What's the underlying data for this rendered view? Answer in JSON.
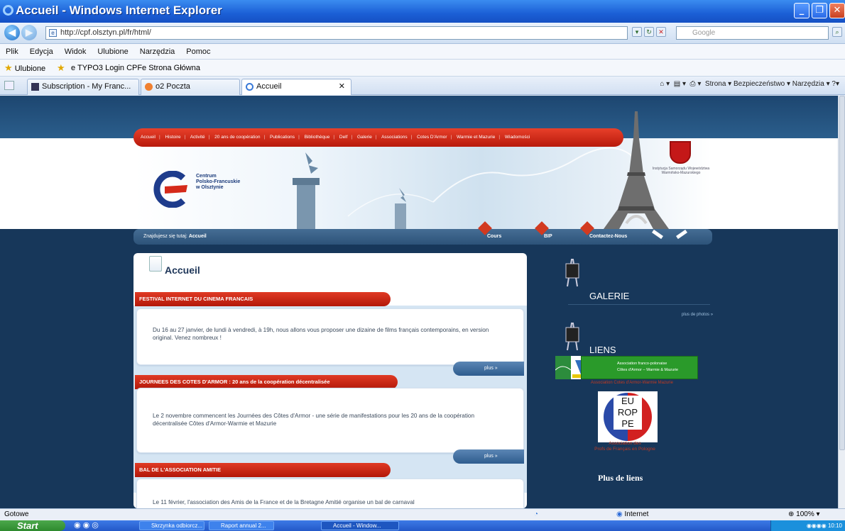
{
  "window": {
    "title": "Accueil - Windows Internet Explorer"
  },
  "address": {
    "url": "http://cpf.olsztyn.pl/fr/html/",
    "search_placeholder": "Google"
  },
  "menu": [
    "Plik",
    "Edycja",
    "Widok",
    "Ulubione",
    "Narzędzia",
    "Pomoc"
  ],
  "favorites": {
    "label": "Ulubione",
    "items": [
      "TYPO3 Login CPF",
      "Strona Główna"
    ]
  },
  "tabs": [
    "Subscription - My Franc...",
    "o2 Poczta",
    "Accueil"
  ],
  "commands": "Strona ▾  Bezpieczeństwo ▾  Narzędzia ▾",
  "site": {
    "nav": [
      "Accueil",
      "Histoire",
      "Activité",
      "20 ans de coopération",
      "Publications",
      "Bibliothèque",
      "Delf",
      "Galerie",
      "Associations",
      "Cotes D'Armor",
      "Warmie et Mazurie",
      "Wiadomości"
    ],
    "logo_text": [
      "Centrum",
      "Polsko-Francuskie",
      "w Olsztynie"
    ],
    "crest_text": "Instytucja Samorządu Województwa Warmińsko-Mazurskiego",
    "breadcrumb_label": "Znajdujesz się tutaj:",
    "breadcrumb": "Accueil",
    "quick_links": [
      "Cours",
      "BIP",
      "Contactez-Nous"
    ],
    "page_title": "Accueil",
    "news": [
      {
        "title": "FESTIVAL INTERNET DU CINEMA FRANCAIS",
        "text": "Du 16 au 27 janvier, de lundi à vendredi, à 19h, nous allons vous proposer une dizaine de films français contemporains, en version original. Venez nombreux !",
        "more": "plus »"
      },
      {
        "title": "JOURNEES DES COTES D'ARMOR : 20 ans de la coopération décentralisée",
        "text": "Le 2 novembre commencent les Journées des Côtes d'Armor - une série de manifestations pour les 20 ans de la coopération décentralisée Côtes d'Armor-Warmie et Mazurie",
        "more": "plus »"
      },
      {
        "title": "BAL DE L'ASSOCIATION AMITIE",
        "text": "Le 11 février, l'association des Amis de la France et de la Bretagne Amitié organise un bal de carnaval"
      }
    ],
    "galerie": {
      "heading": "GALERIE",
      "more": "plus de photos »"
    },
    "liens": {
      "heading": "LIENS",
      "green_line1": "Association franco-polonaise",
      "green_line2": "Côtes d'Armor – Warmie & Mazurie",
      "assoc1": "Association Cotes d'Armor-Warmie Mazurie",
      "eu_letters": [
        "EU",
        "ROP",
        "PE"
      ],
      "assoc2_line1": "Association des",
      "assoc2_line2": "Profs de Français en Pologne",
      "more": "Plus de liens"
    }
  },
  "status": {
    "left": "Gotowe",
    "zone": "Internet",
    "zoom": "100%"
  },
  "taskbar": {
    "start": "Start",
    "tasks": [
      "Skrzynka odbiorcz...",
      "Raport annual 2...",
      "Accueil - Window..."
    ],
    "clock": "10:10"
  }
}
